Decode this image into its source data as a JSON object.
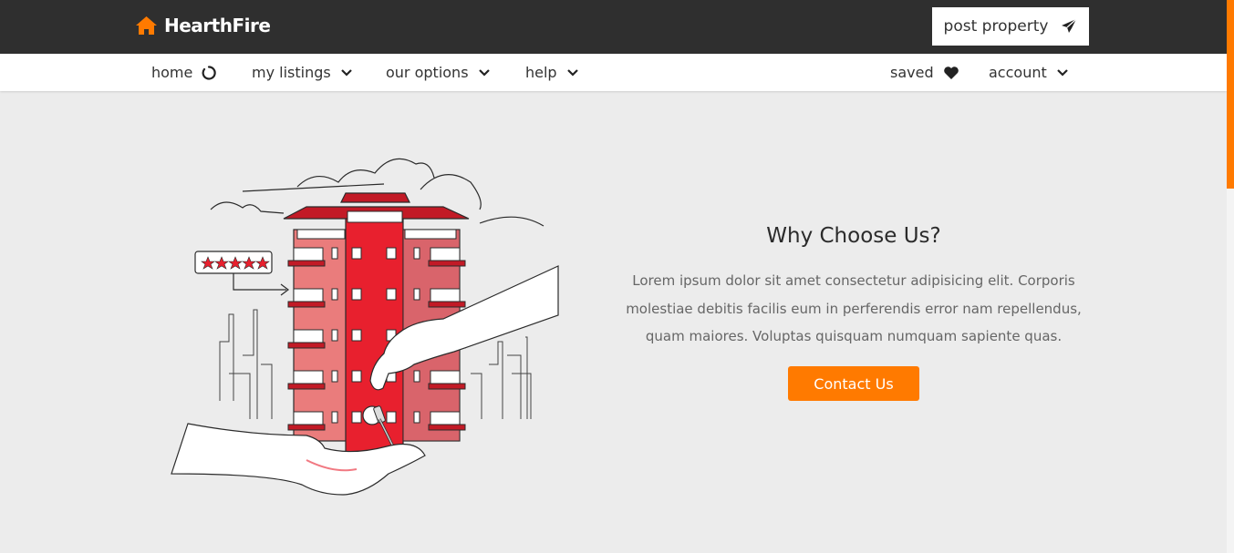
{
  "brand": {
    "name": "HearthFire",
    "icon": "home-icon",
    "accent": "#ff7a00"
  },
  "topbar": {
    "post_label": "post property",
    "post_icon": "paper-plane-icon"
  },
  "nav": {
    "left": [
      {
        "label": "home",
        "icon": "loader-icon"
      },
      {
        "label": "my listings",
        "icon": "chevron-down-icon"
      },
      {
        "label": "our options",
        "icon": "chevron-down-icon"
      },
      {
        "label": "help",
        "icon": "chevron-down-icon"
      }
    ],
    "right": [
      {
        "label": "saved",
        "icon": "heart-icon"
      },
      {
        "label": "account",
        "icon": "chevron-down-icon"
      }
    ]
  },
  "about": {
    "title": "Why Choose Us?",
    "text": "Lorem ipsum dolor sit amet consectetur adipisicing elit. Corporis molestiae debitis facilis eum in perferendis error nam repellendus, quam maiores. Voluptas quisquam numquam sapiente quas.",
    "cta_label": "Contact Us",
    "illustration": "building-key-handover-illustration",
    "rating_stars": 5
  },
  "colors": {
    "topbar": "#2f2f2f",
    "background": "#ececec",
    "building": "#e8202e"
  }
}
